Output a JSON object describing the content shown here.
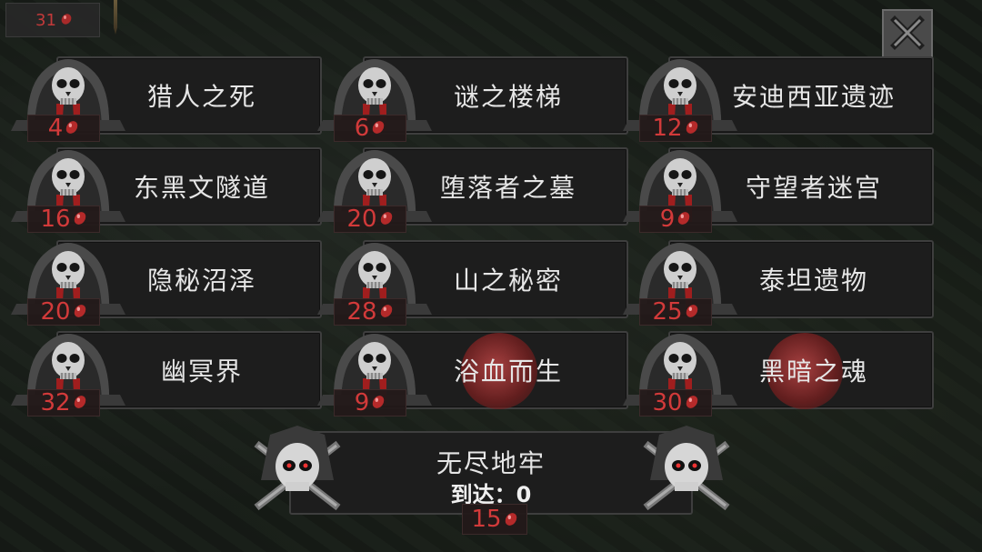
{
  "currency": {
    "value": "31",
    "gem_icon": "red-gem-icon"
  },
  "close": {
    "icon": "close-x-icon"
  },
  "dungeons": [
    {
      "name": "猎人之死",
      "cost": "4",
      "blood_moon": false
    },
    {
      "name": "谜之楼梯",
      "cost": "6",
      "blood_moon": false
    },
    {
      "name": "安迪西亚遗迹",
      "cost": "12",
      "blood_moon": false
    },
    {
      "name": "东黑文隧道",
      "cost": "16",
      "blood_moon": false
    },
    {
      "name": "堕落者之墓",
      "cost": "20",
      "blood_moon": false
    },
    {
      "name": "守望者迷宫",
      "cost": "9",
      "blood_moon": false
    },
    {
      "name": "隐秘沼泽",
      "cost": "20",
      "blood_moon": false
    },
    {
      "name": "山之秘密",
      "cost": "28",
      "blood_moon": false
    },
    {
      "name": "泰坦遗物",
      "cost": "25",
      "blood_moon": false
    },
    {
      "name": "幽冥界",
      "cost": "32",
      "blood_moon": false
    },
    {
      "name": "浴血而生",
      "cost": "9",
      "blood_moon": true
    },
    {
      "name": "黑暗之魂",
      "cost": "30",
      "blood_moon": true
    }
  ],
  "endless": {
    "title": "无尽地牢",
    "reach_label": "到达：0",
    "cost": "15"
  },
  "colors": {
    "cost_red": "#d23a3a",
    "panel": "#1d1d1d",
    "border": "#3e3e3e"
  }
}
